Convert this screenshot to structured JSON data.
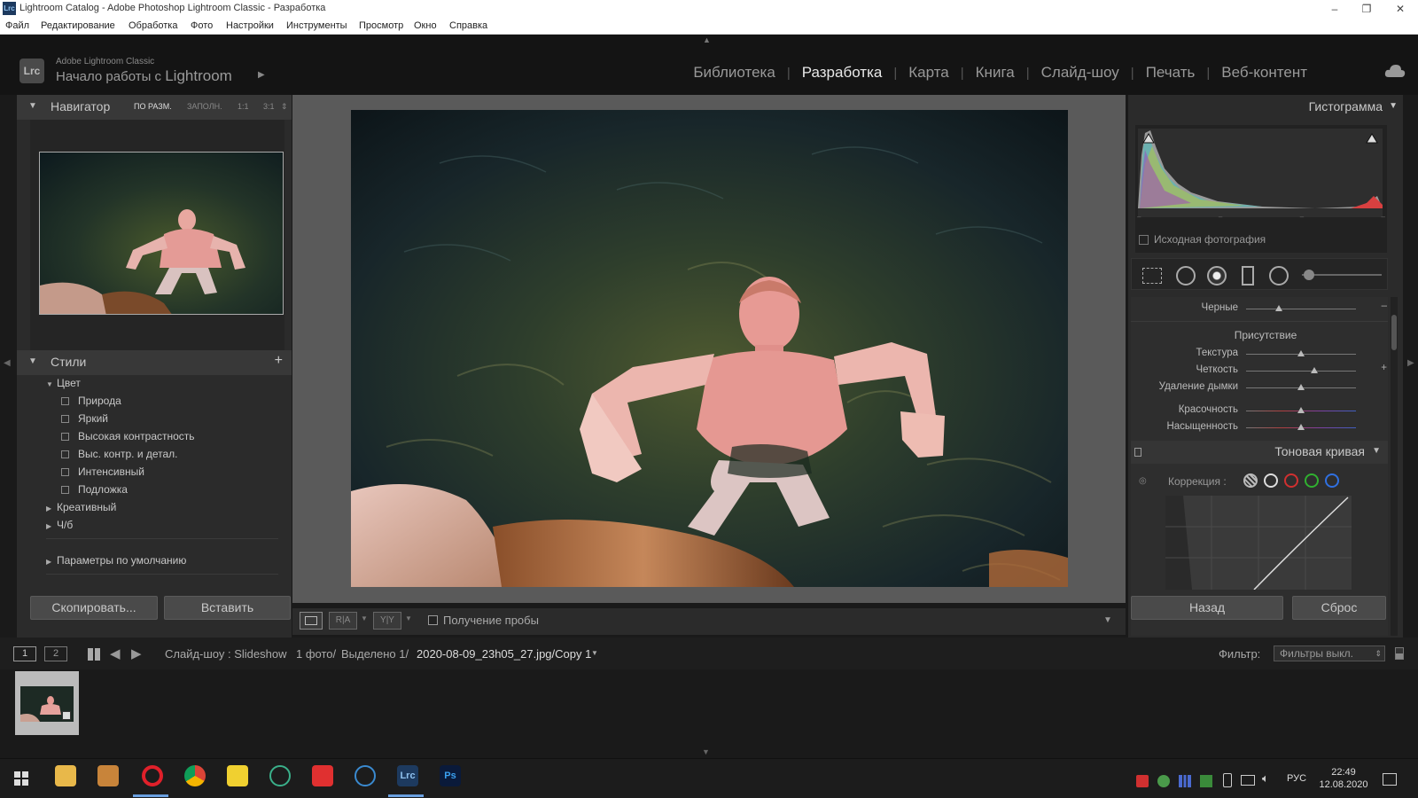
{
  "window": {
    "title": "Lightroom Catalog - Adobe Photoshop Lightroom Classic - Разработка",
    "app_icon": "Lrc",
    "controls": [
      "–",
      "❐",
      "✕"
    ]
  },
  "menu": [
    "Файл",
    "Редактирование",
    "Обработка",
    "Фото",
    "Настройки",
    "Инструменты",
    "Просмотр",
    "Окно",
    "Справка"
  ],
  "brand": {
    "badge": "Lrc",
    "line1": "Adobe Lightroom Classic",
    "line2_prefix": "Начало работы с",
    "line2_app": "Lightroom"
  },
  "modules": {
    "items": [
      "Библиотека",
      "Разработка",
      "Карта",
      "Книга",
      "Слайд-шоу",
      "Печать",
      "Веб-контент"
    ],
    "active": "Разработка"
  },
  "navigator": {
    "title": "Навигатор",
    "options": [
      "ПО РАЗМ.",
      "ЗАПОЛН.",
      "1:1",
      "3:1"
    ]
  },
  "presets": {
    "title": "Стили",
    "add": "+",
    "group_color": "Цвет",
    "color_items": [
      "Природа",
      "Яркий",
      "Высокая контрастность",
      "Выс. контр. и детал.",
      "Интенсивный",
      "Подложка"
    ],
    "group_creative": "Креативный",
    "group_bw": "Ч/б",
    "group_defaults": "Параметры по умолчанию"
  },
  "left_buttons": {
    "copy": "Скопировать...",
    "paste": "Вставить"
  },
  "center_toolbar": {
    "view_ra": "R|A",
    "view_yy": "Y|Y",
    "soft_proof": "Получение пробы"
  },
  "histogram": {
    "title": "Гистограмма",
    "original_photo": "Исходная фотография"
  },
  "basic": {
    "blacks": "Черные",
    "presence_title": "Присутствие",
    "texture": "Текстура",
    "clarity": "Четкость",
    "dehaze": "Удаление дымки",
    "vibrance": "Красочность",
    "saturation": "Насыщенность",
    "slider_values": {
      "blacks": 0.3,
      "texture": 0.5,
      "clarity": 0.62,
      "dehaze": 0.5,
      "vibrance": 0.5,
      "saturation": 0.5
    }
  },
  "tone_curve": {
    "title": "Тоновая кривая",
    "correction_label": "Коррекция :"
  },
  "right_buttons": {
    "back": "Назад",
    "reset": "Сброс"
  },
  "filmbar": {
    "screen1": "1",
    "screen2": "2",
    "source": "Слайд-шоу : Slideshow",
    "count": "1 фото/",
    "selected": "Выделено 1/",
    "filename": "2020-08-09_23h05_27.jpg/Copy 1",
    "filter_label": "Фильтр:",
    "filter_value": "Фильтры выкл."
  },
  "taskbar": {
    "lang": "РУС",
    "time": "22:49",
    "date": "12.08.2020"
  },
  "colors": {
    "panel": "#2b2b2b",
    "panel_header": "#383838",
    "center_bg": "#5a5a5a",
    "topbar": "#141414",
    "active_module": "#e8e8e8"
  }
}
